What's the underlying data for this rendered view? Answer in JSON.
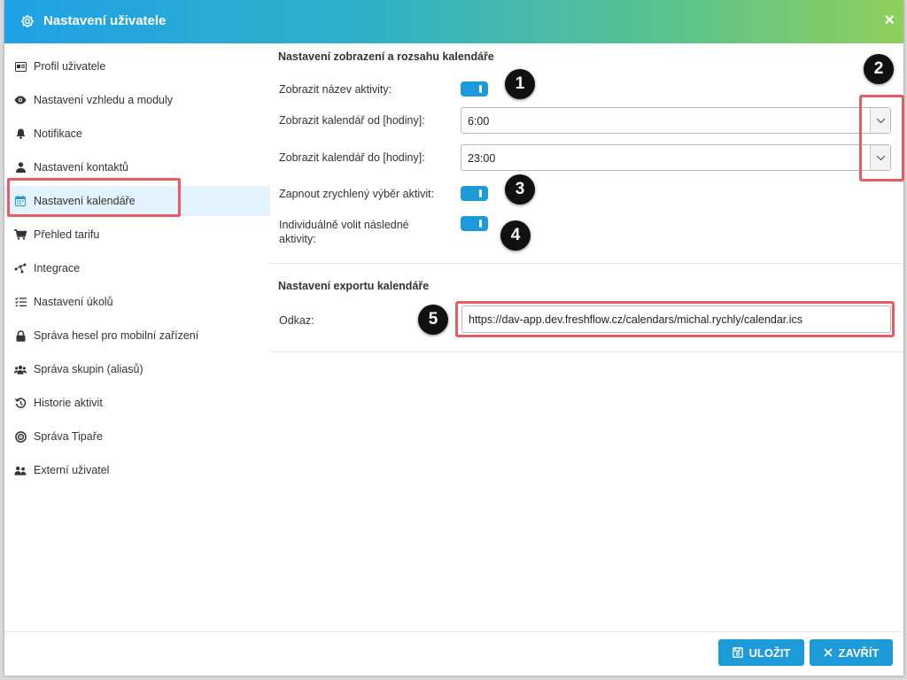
{
  "window": {
    "title": "Nastavení uživatele",
    "title_icon": "gear-icon",
    "close_glyph": "×"
  },
  "sidebar": {
    "active_index": 4,
    "items": [
      {
        "label": "Profil uživatele",
        "icon": "id-card-icon"
      },
      {
        "label": "Nastavení vzhledu a moduly",
        "icon": "eye-icon"
      },
      {
        "label": "Notifikace",
        "icon": "bell-icon"
      },
      {
        "label": "Nastavení kontaktů",
        "icon": "user-icon"
      },
      {
        "label": "Nastavení kalendáře",
        "icon": "calendar-icon"
      },
      {
        "label": "Přehled tarifu",
        "icon": "cart-icon"
      },
      {
        "label": "Integrace",
        "icon": "network-icon"
      },
      {
        "label": "Nastavení úkolů",
        "icon": "tasks-icon"
      },
      {
        "label": "Správa hesel pro mobilní zařízení",
        "icon": "lock-icon"
      },
      {
        "label": "Správa skupin (aliasů)",
        "icon": "users-icon"
      },
      {
        "label": "Historie aktivit",
        "icon": "history-icon"
      },
      {
        "label": "Správa Tipaře",
        "icon": "target-icon"
      },
      {
        "label": "Externí uživatel",
        "icon": "user-group-icon"
      }
    ]
  },
  "calendar_display": {
    "section_title": "Nastavení zobrazení a rozsahu kalendáře",
    "show_activity_name": {
      "label": "Zobrazit název aktivity:",
      "enabled": true
    },
    "show_from": {
      "label": "Zobrazit kalendář od [hodiny]:",
      "value": "6:00"
    },
    "show_to": {
      "label": "Zobrazit kalendář do [hodiny]:",
      "value": "23:00"
    },
    "quick_select": {
      "label": "Zapnout zrychlený výběr aktivit:",
      "enabled": true
    },
    "follow_up": {
      "label_line1": "Individuálně volit následné",
      "label_line2": "aktivity:",
      "enabled": true
    }
  },
  "calendar_export": {
    "section_title": "Nastavení exportu kalendáře",
    "link_label": "Odkaz:",
    "link_value": "https://dav-app.dev.freshflow.cz/calendars/michal.rychly/calendar.ics"
  },
  "markers": [
    "1",
    "2",
    "3",
    "4",
    "5"
  ],
  "footer": {
    "save_label": "ULOŽIT",
    "close_label": "ZAVŘÍT",
    "save_icon": "save-icon",
    "close_icon": "close-icon"
  },
  "colors": {
    "accent": "#1d9ad8",
    "highlight": "#e95a62",
    "header_gradient_start": "#1ea1e6",
    "header_gradient_end": "#8fcf5a",
    "active_bg": "#e3f3fd"
  }
}
